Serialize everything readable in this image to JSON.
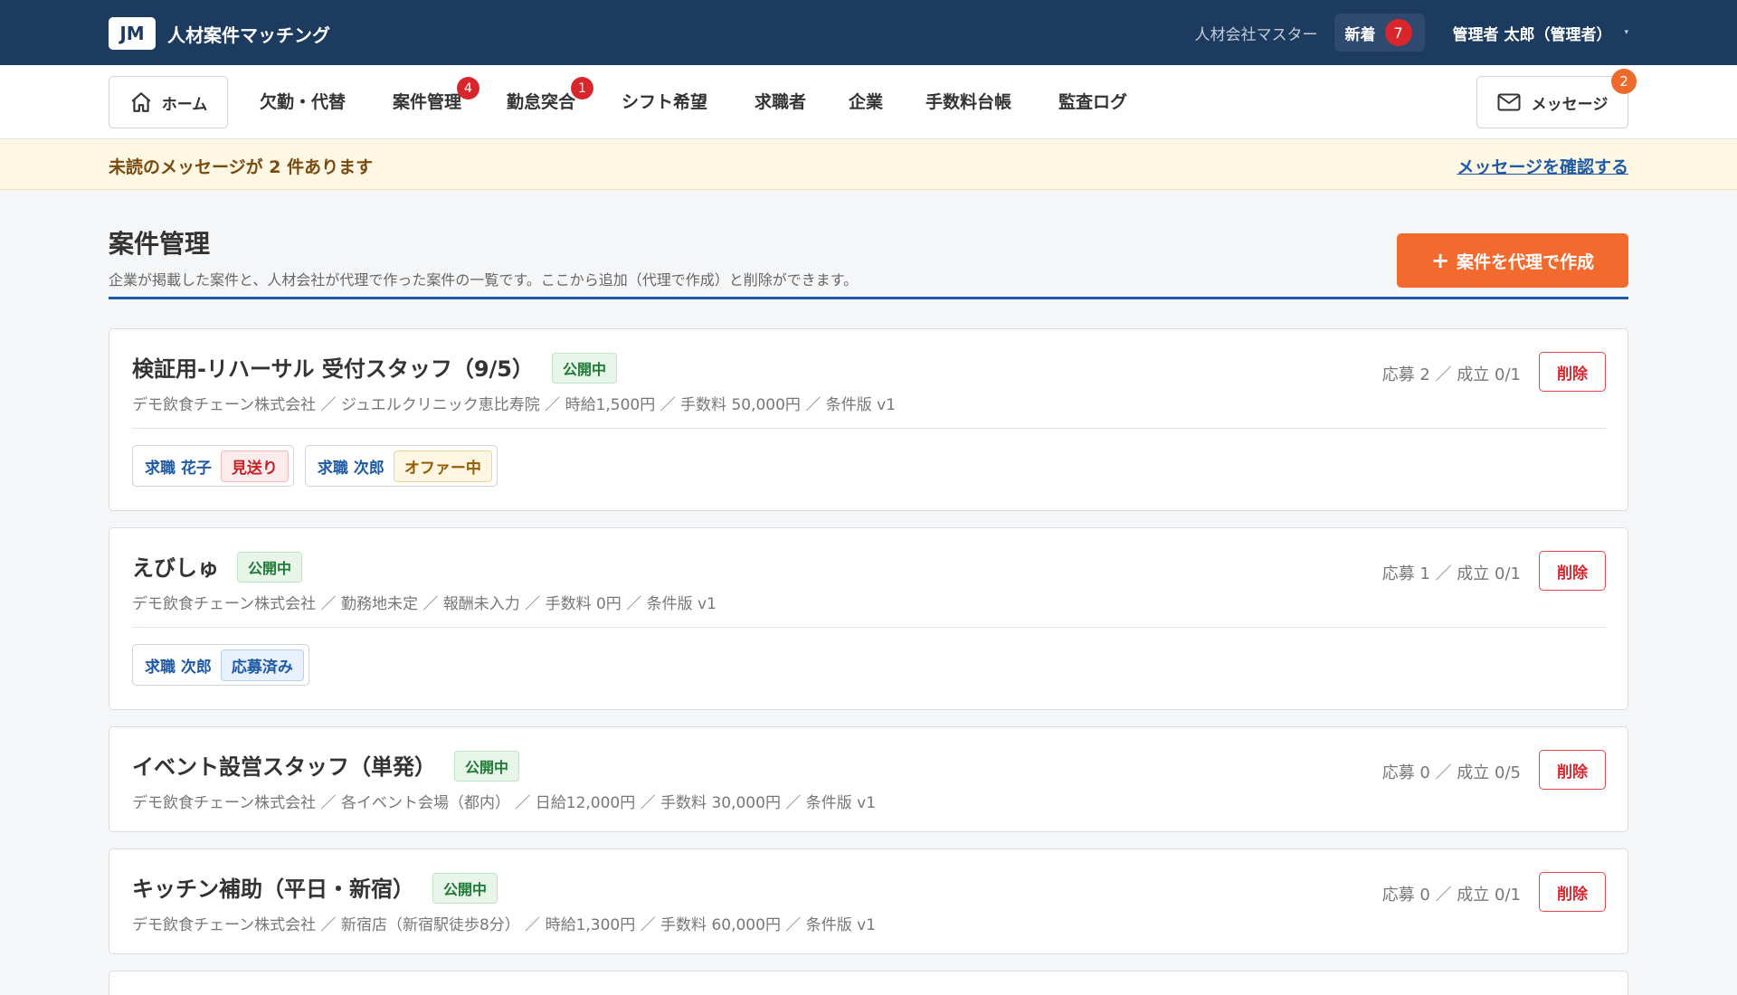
{
  "header": {
    "logo": "JM",
    "app_name": "人材案件マッチング",
    "company": "人材会社マスター",
    "new_label": "新着",
    "new_count": "7",
    "user": "管理者 太郎（管理者）",
    "caret": "▾"
  },
  "nav": {
    "home": "ホーム",
    "items": [
      {
        "label": "欠勤・代替",
        "badge": ""
      },
      {
        "label": "案件管理",
        "badge": "4"
      },
      {
        "label": "勤怠突合",
        "badge": "1"
      },
      {
        "label": "シフト希望",
        "badge": ""
      },
      {
        "label": "求職者",
        "badge": ""
      },
      {
        "label": "企業",
        "badge": ""
      },
      {
        "label": "手数料台帳",
        "badge": ""
      },
      {
        "label": "監査ログ",
        "badge": ""
      }
    ],
    "messages_label": "メッセージ",
    "messages_count": "2"
  },
  "notice": {
    "text": "未読のメッセージが 2 件あります",
    "link": "メッセージを確認する"
  },
  "page": {
    "title": "案件管理",
    "description": "企業が掲載した案件と、人材会社が代理で作った案件の一覧です。ここから追加（代理で作成）と削除ができます。",
    "create_plus": "+",
    "create_label": "案件を代理で作成"
  },
  "jobs": [
    {
      "title": "検証用-リハーサル 受付スタッフ（9/5）",
      "status": "公開中",
      "meta": "デモ飲食チェーン株式会社 ／ ジュエルクリニック恵比寿院 ／ 時給1,500円 ／ 手数料 50,000円 ／ 条件版 v1",
      "stats": "応募 2 ／ 成立 0/1",
      "delete": "削除",
      "applicants": [
        {
          "name": "求職 花子",
          "state": "見送り"
        },
        {
          "name": "求職 次郎",
          "state": "オファー中"
        }
      ]
    },
    {
      "title": "えびしゅ",
      "status": "公開中",
      "meta": "デモ飲食チェーン株式会社 ／ 勤務地未定 ／ 報酬未入力 ／ 手数料 0円 ／ 条件版 v1",
      "stats": "応募 1 ／ 成立 0/1",
      "delete": "削除",
      "applicants": [
        {
          "name": "求職 次郎",
          "state": "応募済み"
        }
      ]
    },
    {
      "title": "イベント設営スタッフ（単発）",
      "status": "公開中",
      "meta": "デモ飲食チェーン株式会社 ／ 各イベント会場（都内） ／ 日給12,000円 ／ 手数料 30,000円 ／ 条件版 v1",
      "stats": "応募 0 ／ 成立 0/5",
      "delete": "削除",
      "applicants": []
    },
    {
      "title": "キッチン補助（平日・新宿）",
      "status": "公開中",
      "meta": "デモ飲食チェーン株式会社 ／ 新宿店（新宿駅徒歩8分） ／ 時給1,300円 ／ 手数料 60,000円 ／ 条件版 v1",
      "stats": "応募 0 ／ 成立 0/1",
      "delete": "削除",
      "applicants": []
    }
  ]
}
